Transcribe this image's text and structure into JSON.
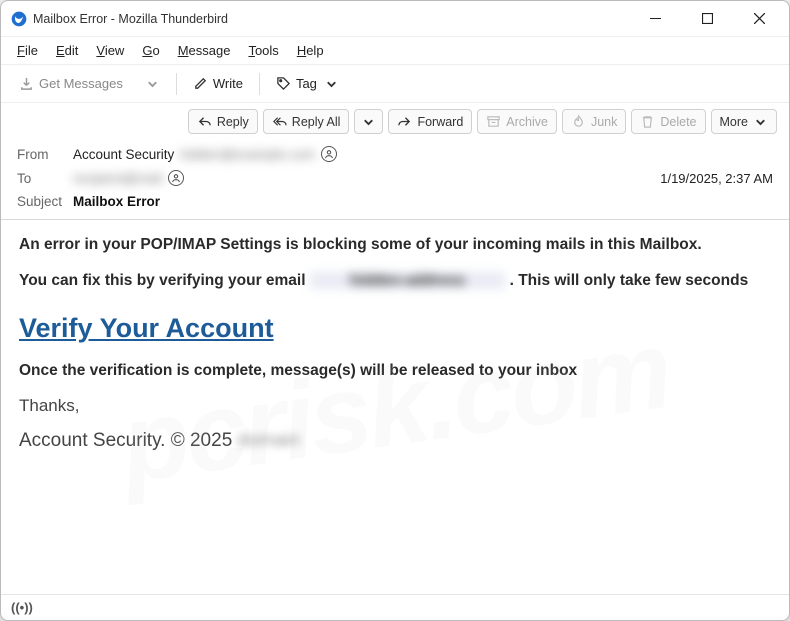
{
  "window": {
    "title": "Mailbox Error - Mozilla Thunderbird"
  },
  "menubar": [
    "File",
    "Edit",
    "View",
    "Go",
    "Message",
    "Tools",
    "Help"
  ],
  "toolbar": {
    "get_messages": "Get Messages",
    "write": "Write",
    "tag": "Tag"
  },
  "msg_actions": {
    "reply": "Reply",
    "reply_all": "Reply All",
    "forward": "Forward",
    "archive": "Archive",
    "junk": "Junk",
    "delete": "Delete",
    "more": "More"
  },
  "headers": {
    "from_label": "From",
    "from_value": "Account Security",
    "from_hidden": "hidden@example.com",
    "to_label": "To",
    "to_hidden": "recipient@mail",
    "timestamp": "1/19/2025, 2:37 AM",
    "subject_label": "Subject",
    "subject_value": "Mailbox Error"
  },
  "body": {
    "line1": "An error in your POP/IMAP Settings is blocking some of your incoming mails in this Mailbox.",
    "line2a": "You can fix this by verifying your email",
    "line2_hidden": "hidden-address",
    "line2b": ". This will only take few seconds",
    "verify": "Verify Your Account",
    "line3": "Once the verification is complete, message(s) will be released to your inbox",
    "thanks": "Thanks,",
    "sig": "Account Security. © 2025",
    "sig_hidden": "domain"
  },
  "status": {
    "online": "((•))"
  }
}
